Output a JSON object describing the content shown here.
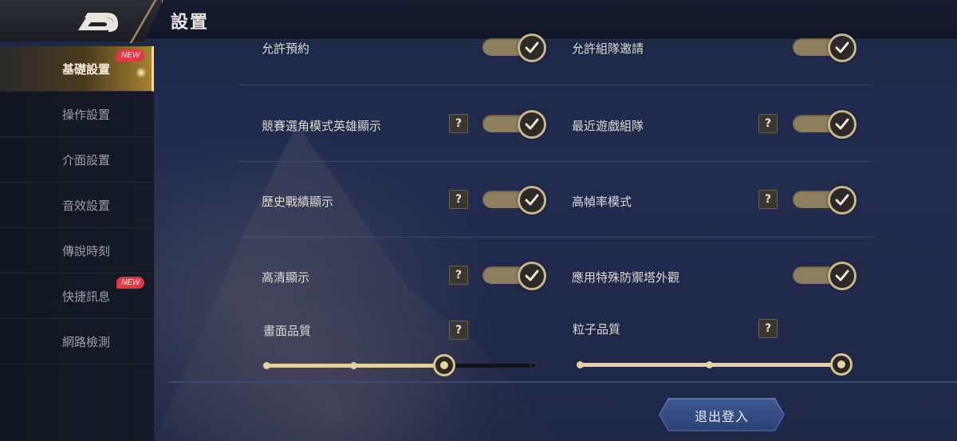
{
  "header": {
    "title": "設置"
  },
  "sidebar": {
    "items": [
      {
        "label": "基礎設置",
        "badge": "NEW"
      },
      {
        "label": "操作設置",
        "badge": ""
      },
      {
        "label": "介面設置",
        "badge": ""
      },
      {
        "label": "音效設置",
        "badge": ""
      },
      {
        "label": "傳說時刻",
        "badge": ""
      },
      {
        "label": "快捷訊息",
        "badge": "NEW"
      },
      {
        "label": "網路檢測",
        "badge": ""
      }
    ],
    "active_index": 0
  },
  "settings": {
    "allow_reservation": {
      "label": "允許預約",
      "enabled": true
    },
    "allow_team_invite": {
      "label": "允許組隊邀請",
      "enabled": true
    },
    "ranked_pick_hero_display": {
      "label": "競賽選角模式英雄顯示",
      "help": "?",
      "enabled": true
    },
    "recent_team": {
      "label": "最近遊戲組隊",
      "help": "?",
      "enabled": true
    },
    "history_record_display": {
      "label": "歷史戰績顯示",
      "help": "?",
      "enabled": true
    },
    "high_fps_mode": {
      "label": "高幀率模式",
      "help": "?",
      "enabled": true
    },
    "hd_display": {
      "label": "高清顯示",
      "help": "?",
      "enabled": true
    },
    "special_tower_skin": {
      "label": "應用特殊防禦塔外觀",
      "enabled": true
    },
    "graphics_quality": {
      "label": "畫面品質",
      "help": "?",
      "level": 3,
      "max_level": 4
    },
    "particle_quality": {
      "label": "粒子品質",
      "help": "?",
      "level": 3,
      "max_level": 3
    }
  },
  "footer": {
    "logout_label": "退出登入"
  },
  "colors": {
    "accent_gold": "#e6d2a0",
    "badge_red": "#e33744",
    "logout_blue": "#3d568f"
  },
  "icons": {
    "back": "back-arrow-icon",
    "check": "checkmark-icon",
    "help": "question-mark-icon"
  }
}
